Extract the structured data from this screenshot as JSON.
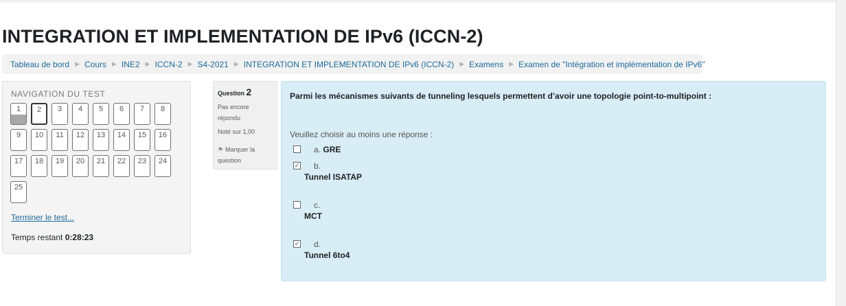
{
  "page": {
    "title": "INTEGRATION ET IMPLEMENTATION DE IPv6 (ICCN-2)"
  },
  "breadcrumb": [
    "Tableau de bord",
    "Cours",
    "INE2",
    "ICCN-2",
    "S4-2021",
    "INTEGRATION ET IMPLEMENTATION DE IPv6 (ICCN-2)",
    "Examens",
    "Examen de \"Intégration et implémentation de IPv6\""
  ],
  "nav": {
    "title": "NAVIGATION DU TEST",
    "questions": [
      "1",
      "2",
      "3",
      "4",
      "5",
      "6",
      "7",
      "8",
      "9",
      "10",
      "11",
      "12",
      "13",
      "14",
      "15",
      "16",
      "17",
      "18",
      "19",
      "20",
      "21",
      "22",
      "23",
      "24",
      "25"
    ],
    "answered": [
      "1"
    ],
    "current": "2",
    "finish_link": "Terminer le test...",
    "timer_label": "Temps restant",
    "timer_value": "0:28:23"
  },
  "question_info": {
    "label": "Question",
    "number": "2",
    "state": "Pas encore répondu",
    "grade": "Noté sur 1,00",
    "flag": "Marquer la question"
  },
  "question": {
    "text": "Parmi les mécanismes suivants de tunneling lesquels permettent d’avoir une topologie point-to-multipoint :",
    "prompt": "Veuillez choisir au moins une réponse :",
    "options": [
      {
        "letter": "a.",
        "label": "GRE",
        "checked": false
      },
      {
        "letter": "b.",
        "label": "Tunnel ISATAP",
        "checked": true
      },
      {
        "letter": "c.",
        "label": "MCT",
        "checked": false
      },
      {
        "letter": "d.",
        "label": "Tunnel 6to4",
        "checked": true
      }
    ]
  },
  "icons": {
    "breadcrumb_separator": "triangle-right-icon",
    "flag": "flag-icon",
    "checkbox_checked": "check-icon"
  }
}
